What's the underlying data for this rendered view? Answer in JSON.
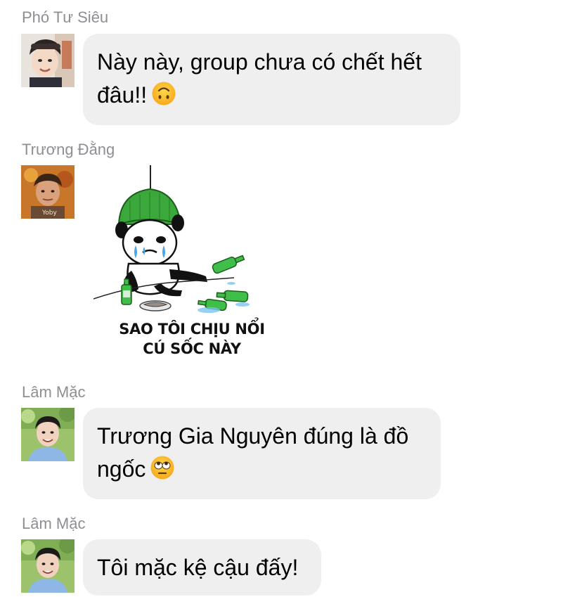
{
  "messages": [
    {
      "sender": "Phó Tư Siêu",
      "avatar_icon": "profile-photo-icon",
      "text": "Này này, group chưa có chết hết đâu!!",
      "emoji": "upside-down-face-emoji"
    },
    {
      "sender": "Trương Đằng",
      "avatar_icon": "profile-photo-icon",
      "sticker": {
        "icon": "crying-panda-meme-sticker",
        "caption_line1": "SAO TÔI CHỊU NỔI",
        "caption_line2": "CÚ SỐC NÀY"
      }
    },
    {
      "sender": "Lâm Mặc",
      "avatar_icon": "profile-photo-icon",
      "text": "Trương Gia Nguyên đúng là đồ ngốc",
      "emoji": "eye-roll-face-emoji"
    },
    {
      "sender": "Lâm Mặc",
      "avatar_icon": "profile-photo-icon",
      "text": "Tôi mặc kệ cậu đấy!"
    }
  ],
  "colors": {
    "bubble_background": "#efeff0",
    "sender_name": "#8e8e93",
    "message_text": "#000000"
  }
}
